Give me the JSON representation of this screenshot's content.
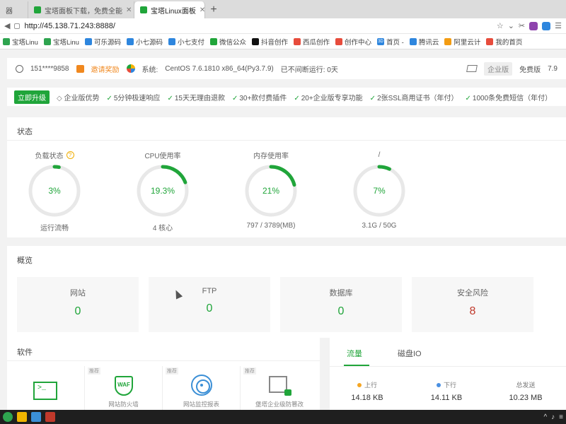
{
  "browser": {
    "tabs": [
      {
        "label": "器"
      },
      {
        "label": "宝塔面板下载，免费全能"
      },
      {
        "label": "宝塔Linux面板",
        "active": true
      }
    ],
    "new_tab_symbol": "+",
    "url": "http://45.138.71.243:8888/",
    "bookmarks": [
      "宝塔Linu",
      "宝塔Linu",
      "可乐源码",
      "小七源码",
      "小七支付",
      "微信公众",
      "抖音创作",
      "西瓜创作",
      "创作中心",
      "首页 -",
      "腾讯云",
      "阿里云计",
      "我的首页"
    ],
    "bookmark_prefix": "3D"
  },
  "user": {
    "phone": "151****9858",
    "invite_label": "邀请奖励",
    "system_label": "系统:",
    "system_value": "CentOS 7.6.1810 x86_64(Py3.7.9)",
    "uptime_label": "已不间断运行: 0天",
    "edition_badge": "企业版",
    "free_version": "免费版",
    "version_number": "7.9"
  },
  "promo": {
    "upgrade_label": "立即升级",
    "advantage_label": "企业版优势",
    "features": [
      "5分钟极速响应",
      "15天无理由退款",
      "30+款付费插件",
      "20+企业版专享功能",
      "2张SSL商用证书（年付）",
      "1000条免费短信（年付）"
    ]
  },
  "status": {
    "title": "状态",
    "gauges": [
      {
        "label": "负载状态",
        "value": "3%",
        "fraction": 0.03,
        "sub": "运行流畅",
        "help": "?"
      },
      {
        "label": "CPU使用率",
        "value": "19.3%",
        "fraction": 0.193,
        "sub": "4 核心"
      },
      {
        "label": "内存使用率",
        "value": "21%",
        "fraction": 0.21,
        "sub": "797 / 3789(MB)"
      },
      {
        "label": "/",
        "value": "7%",
        "fraction": 0.07,
        "sub": "3.1G / 50G"
      }
    ],
    "color_ok": "#20a53a"
  },
  "overview": {
    "title": "概览",
    "items": [
      {
        "label": "网站",
        "value": "0"
      },
      {
        "label": "FTP",
        "value": "0"
      },
      {
        "label": "数据库",
        "value": "0"
      },
      {
        "label": "安全风险",
        "value": "8"
      }
    ]
  },
  "software": {
    "title": "软件",
    "items": [
      {
        "tag": "",
        "name": ""
      },
      {
        "tag": "推荐",
        "name": "网站防火墙"
      },
      {
        "tag": "推荐",
        "name": "网站监控报表"
      },
      {
        "tag": "推荐",
        "name": "堡塔企业级防篡改"
      }
    ],
    "waf_text": "WAF"
  },
  "traffic": {
    "tabs": [
      "流量",
      "磁盘IO"
    ],
    "stats": [
      {
        "label": "上行",
        "value": "14.18 KB",
        "color": "#f5a623"
      },
      {
        "label": "下行",
        "value": "14.11 KB",
        "color": "#4a90e2"
      },
      {
        "label": "总发送",
        "value": "10.23 MB",
        "color": ""
      }
    ]
  }
}
